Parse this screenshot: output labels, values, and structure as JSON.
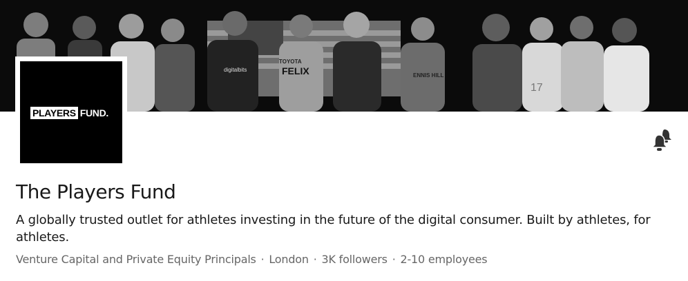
{
  "cover": {
    "flag_word": "FELIX",
    "jersey_text": "ENNIS HILL",
    "shirt_number": "17",
    "sponsor_text": "digitalbits",
    "team_text": "TOYOTA"
  },
  "logo": {
    "text_players": "PLAYERS",
    "text_fund": "FUND."
  },
  "company": {
    "name": "The Players Fund",
    "tagline": "A globally trusted outlet for athletes investing in the future of the digital consumer. Built by athletes, for athletes.",
    "industry": "Venture Capital and Private Equity Principals",
    "location": "London",
    "followers": "3K followers",
    "employees": "2-10 employees",
    "separator": "·"
  },
  "icons": {
    "notify": "bell-add-icon"
  }
}
